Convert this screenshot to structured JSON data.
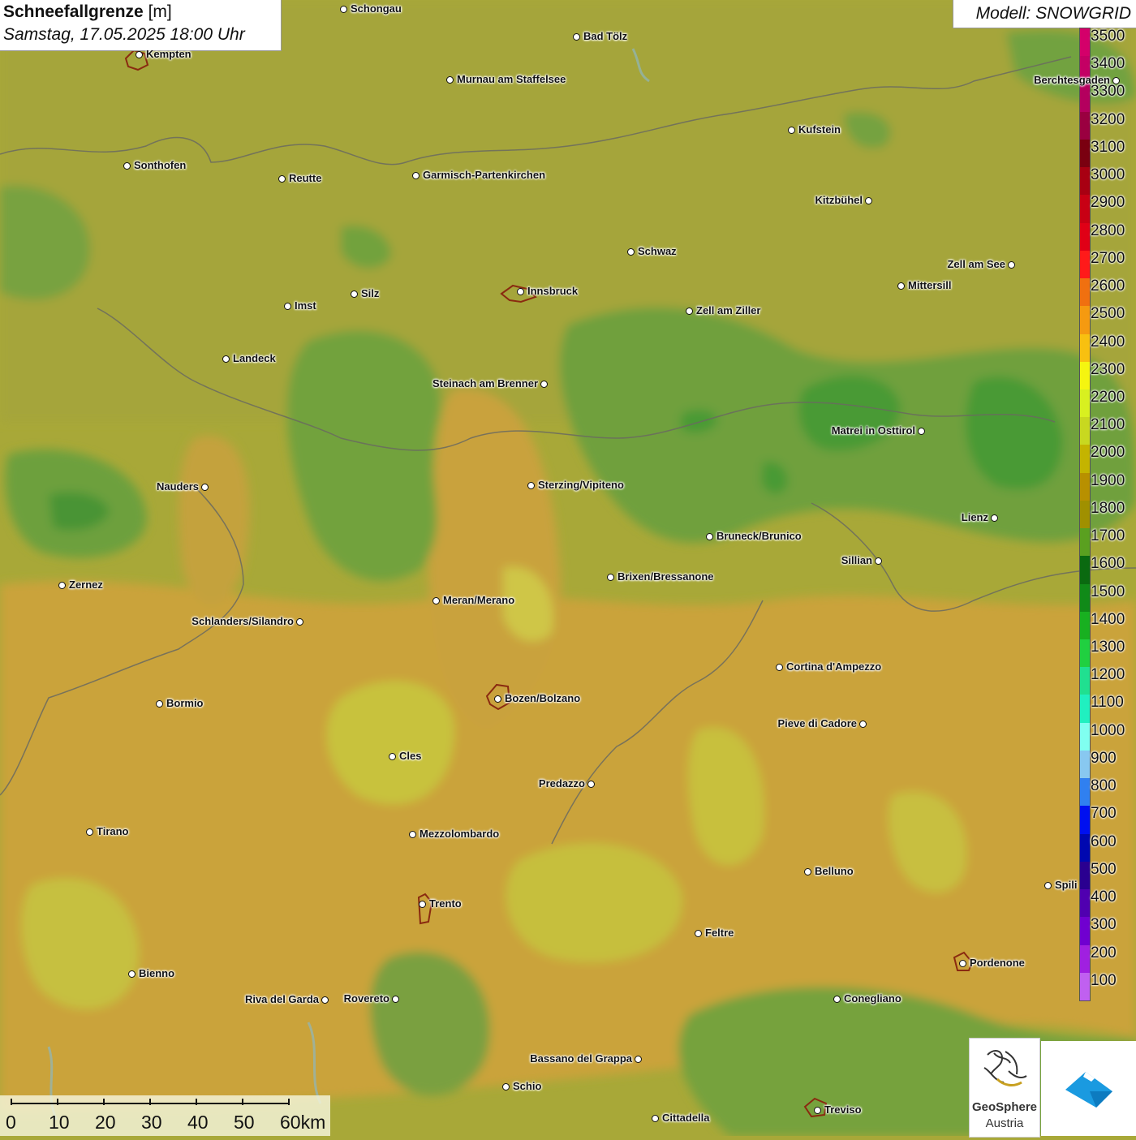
{
  "header": {
    "title": "Schneefallgrenze",
    "unit": "[m]",
    "datetime": "Samstag, 17.05.2025 18:00 Uhr"
  },
  "model": "Modell: SNOWGRID",
  "legend": {
    "levels": [
      {
        "value": "3500",
        "color": "#d4006a"
      },
      {
        "value": "3400",
        "color": "#c40064"
      },
      {
        "value": "3300",
        "color": "#b4005e"
      },
      {
        "value": "3200",
        "color": "#9a0040"
      },
      {
        "value": "3100",
        "color": "#7a0010"
      },
      {
        "value": "3000",
        "color": "#a80012"
      },
      {
        "value": "2900",
        "color": "#c80014"
      },
      {
        "value": "2800",
        "color": "#e00016"
      },
      {
        "value": "2700",
        "color": "#ff1a1a"
      },
      {
        "value": "2600",
        "color": "#f07010"
      },
      {
        "value": "2500",
        "color": "#f59a10"
      },
      {
        "value": "2400",
        "color": "#f8c010"
      },
      {
        "value": "2300",
        "color": "#f5f510"
      },
      {
        "value": "2200",
        "color": "#d8f020"
      },
      {
        "value": "2100",
        "color": "#c8d820"
      },
      {
        "value": "2000",
        "color": "#c4b400"
      },
      {
        "value": "1900",
        "color": "#b89000"
      },
      {
        "value": "1800",
        "color": "#a09000"
      },
      {
        "value": "1700",
        "color": "#5aa020"
      },
      {
        "value": "1600",
        "color": "#0a6a10"
      },
      {
        "value": "1500",
        "color": "#108a18"
      },
      {
        "value": "1400",
        "color": "#18b020"
      },
      {
        "value": "1300",
        "color": "#20d040"
      },
      {
        "value": "1200",
        "color": "#20e090"
      },
      {
        "value": "1100",
        "color": "#20f0c0"
      },
      {
        "value": "1000",
        "color": "#80fff0"
      },
      {
        "value": "900",
        "color": "#88c8f0"
      },
      {
        "value": "800",
        "color": "#3080f0"
      },
      {
        "value": "700",
        "color": "#0010f0"
      },
      {
        "value": "600",
        "color": "#0008b0"
      },
      {
        "value": "500",
        "color": "#2a0090"
      },
      {
        "value": "400",
        "color": "#5000b0"
      },
      {
        "value": "300",
        "color": "#7000d0"
      },
      {
        "value": "200",
        "color": "#a020e0"
      },
      {
        "value": "100",
        "color": "#c060f0"
      }
    ]
  },
  "places": [
    {
      "name": "Schongau",
      "side": "right"
    },
    {
      "name": "Bad Tölz",
      "side": "right"
    },
    {
      "name": "Kempten",
      "side": "right"
    },
    {
      "name": "Murnau am Staffelsee",
      "side": "right"
    },
    {
      "name": "Berchtesgaden",
      "side": "left"
    },
    {
      "name": "Kufstein",
      "side": "right"
    },
    {
      "name": "Sonthofen",
      "side": "right"
    },
    {
      "name": "Reutte",
      "side": "right"
    },
    {
      "name": "Garmisch-Partenkirchen",
      "side": "right"
    },
    {
      "name": "Kitzbühel",
      "side": "left"
    },
    {
      "name": "Schwaz",
      "side": "right"
    },
    {
      "name": "Zell am See",
      "side": "left"
    },
    {
      "name": "Innsbruck",
      "side": "right"
    },
    {
      "name": "Mittersill",
      "side": "right"
    },
    {
      "name": "Imst",
      "side": "right"
    },
    {
      "name": "Silz",
      "side": "right"
    },
    {
      "name": "Zell am Ziller",
      "side": "right"
    },
    {
      "name": "Landeck",
      "side": "right"
    },
    {
      "name": "Steinach am Brenner",
      "side": "left"
    },
    {
      "name": "Matrei in Osttirol",
      "side": "left"
    },
    {
      "name": "Nauders",
      "side": "left"
    },
    {
      "name": "Sterzing/Vipiteno",
      "side": "right"
    },
    {
      "name": "Lienz",
      "side": "left"
    },
    {
      "name": "Bruneck/Brunico",
      "side": "right"
    },
    {
      "name": "Sillian",
      "side": "left"
    },
    {
      "name": "Zernez",
      "side": "right"
    },
    {
      "name": "Brixen/Bressanone",
      "side": "right"
    },
    {
      "name": "Meran/Merano",
      "side": "right"
    },
    {
      "name": "Schlanders/Silandro",
      "side": "left"
    },
    {
      "name": "Cortina d'Ampezzo",
      "side": "right"
    },
    {
      "name": "Bozen/Bolzano",
      "side": "right"
    },
    {
      "name": "Bormio",
      "side": "right"
    },
    {
      "name": "Pieve di Cadore",
      "side": "left"
    },
    {
      "name": "Cles",
      "side": "right"
    },
    {
      "name": "Predazzo",
      "side": "left"
    },
    {
      "name": "Tirano",
      "side": "right"
    },
    {
      "name": "Mezzolombardo",
      "side": "right"
    },
    {
      "name": "Belluno",
      "side": "right"
    },
    {
      "name": "Spili",
      "side": "right"
    },
    {
      "name": "Trento",
      "side": "right"
    },
    {
      "name": "Feltre",
      "side": "right"
    },
    {
      "name": "Pordenone",
      "side": "right"
    },
    {
      "name": "Bienno",
      "side": "right"
    },
    {
      "name": "Riva del Garda",
      "side": "left"
    },
    {
      "name": "Rovereto",
      "side": "left"
    },
    {
      "name": "Conegliano",
      "side": "right"
    },
    {
      "name": "Bassano del Grappa",
      "side": "left"
    },
    {
      "name": "Schio",
      "side": "right"
    },
    {
      "name": "Treviso",
      "side": "right"
    },
    {
      "name": "Cittadella",
      "side": "right"
    }
  ],
  "scale_bar": {
    "labels": [
      "0",
      "10",
      "20",
      "30",
      "40",
      "50",
      "60km"
    ]
  },
  "logos": {
    "geosphere_line1": "GeoSphere",
    "geosphere_line2": "Austria"
  }
}
